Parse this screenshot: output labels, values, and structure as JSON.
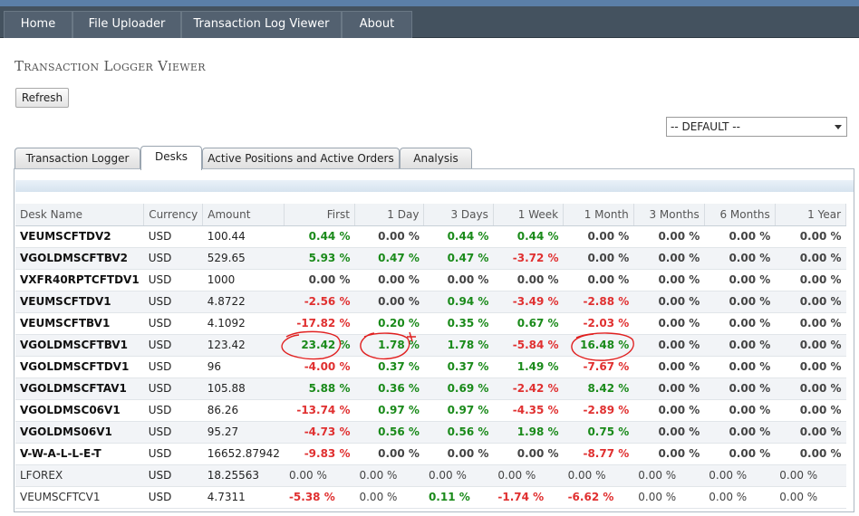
{
  "nav": {
    "items": [
      "Home",
      "File Uploader",
      "Transaction Log Viewer",
      "About"
    ]
  },
  "title": "Transaction Logger Viewer",
  "refresh_label": "Refresh",
  "select_value": "-- DEFAULT --",
  "tabs": [
    "Transaction Logger",
    "Desks",
    "Active Positions and Active Orders",
    "Analysis"
  ],
  "active_tab": "Desks",
  "table": {
    "headers": [
      "Desk Name",
      "Currency",
      "Amount",
      "First",
      "1 Day",
      "3 Days",
      "1 Week",
      "1 Month",
      "3 Months",
      "6 Months",
      "1 Year"
    ],
    "rows": [
      [
        "VEUMSCFTDV2",
        "USD",
        "100.44",
        "0.44 %",
        "0.00 %",
        "0.44 %",
        "0.44 %",
        "0.00 %",
        "0.00 %",
        "0.00 %",
        "0.00 %"
      ],
      [
        "VGOLDMSCFTBV2",
        "USD",
        "529.65",
        "5.93 %",
        "0.47 %",
        "0.47 %",
        "-3.72 %",
        "0.00 %",
        "0.00 %",
        "0.00 %",
        "0.00 %"
      ],
      [
        "VXFR40RPTCFTDV1",
        "USD",
        "1000",
        "0.00 %",
        "0.00 %",
        "0.00 %",
        "0.00 %",
        "0.00 %",
        "0.00 %",
        "0.00 %",
        "0.00 %"
      ],
      [
        "VEUMSCFTDV1",
        "USD",
        "4.8722",
        "-2.56 %",
        "0.00 %",
        "0.94 %",
        "-3.49 %",
        "-2.88 %",
        "0.00 %",
        "0.00 %",
        "0.00 %"
      ],
      [
        "VEUMSCFTBV1",
        "USD",
        "4.1092",
        "-17.82 %",
        "0.20 %",
        "0.35 %",
        "0.67 %",
        "-2.03 %",
        "0.00 %",
        "0.00 %",
        "0.00 %"
      ],
      [
        "VGOLDMSCFTBV1",
        "USD",
        "123.42",
        "23.42 %",
        "1.78 %",
        "1.78 %",
        "-5.84 %",
        "16.48 %",
        "0.00 %",
        "0.00 %",
        "0.00 %"
      ],
      [
        "VGOLDMSCFTDV1",
        "USD",
        "96",
        "-4.00 %",
        "0.37 %",
        "0.37 %",
        "1.49 %",
        "-7.67 %",
        "0.00 %",
        "0.00 %",
        "0.00 %"
      ],
      [
        "VGOLDMSCFTAV1",
        "USD",
        "105.88",
        "5.88 %",
        "0.36 %",
        "0.69 %",
        "-2.42 %",
        "8.42 %",
        "0.00 %",
        "0.00 %",
        "0.00 %"
      ],
      [
        "VGOLDMSC06V1",
        "USD",
        "86.26",
        "-13.74 %",
        "0.97 %",
        "0.97 %",
        "-4.35 %",
        "-2.89 %",
        "0.00 %",
        "0.00 %",
        "0.00 %"
      ],
      [
        "VGOLDMS06V1",
        "USD",
        "95.27",
        "-4.73 %",
        "0.56 %",
        "0.56 %",
        "1.98 %",
        "0.75 %",
        "0.00 %",
        "0.00 %",
        "0.00 %"
      ],
      [
        "V-W-A-L-L-E-T",
        "USD",
        "16652.87942",
        "-9.83 %",
        "0.00 %",
        "0.00 %",
        "0.00 %",
        "-8.77 %",
        "0.00 %",
        "0.00 %",
        "0.00 %"
      ],
      [
        "LFOREX",
        "USD",
        "18.25563",
        "0.00 %",
        "0.00 %",
        "0.00 %",
        "0.00 %",
        "0.00 %",
        "0.00 %",
        "0.00 %",
        "0.00 %"
      ],
      [
        "VEUMSCFTCV1",
        "USD",
        "4.7311",
        "-5.38 %",
        "0.00 %",
        "0.11 %",
        "-1.74 %",
        "-6.62 %",
        "0.00 %",
        "0.00 %",
        "0.00 %"
      ]
    ],
    "plain_rows": [
      11,
      12
    ]
  },
  "colors": {
    "positive": "#1a8a1a",
    "negative": "#e03030",
    "annotation": "#e02020",
    "nav_bg": "#44525f"
  }
}
